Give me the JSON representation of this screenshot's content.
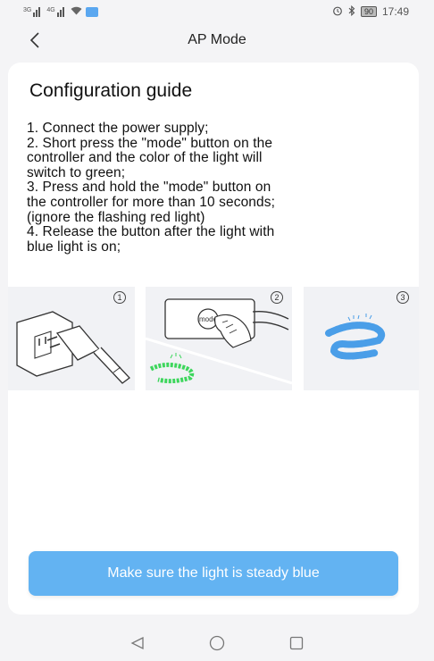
{
  "status_bar": {
    "sig1_tag": "3G",
    "sig2_tag": "4G",
    "battery": "90",
    "time": "17:49"
  },
  "header": {
    "title": "AP Mode"
  },
  "guide": {
    "title": "Configuration guide",
    "lines": [
      "1. Connect the power supply;",
      "2. Short press the \"mode\" button on the",
      "controller and the color of the light will",
      "switch to green;",
      "3. Press and hold the \"mode\" button on",
      "the controller for more than 10 seconds;",
      "(ignore the flashing red light)",
      "4. Release the button after the light with",
      "blue light is on;"
    ]
  },
  "illustrations": [
    {
      "step": "1",
      "icon": "plug-icon"
    },
    {
      "step": "2",
      "icon": "mode-button-icon",
      "button_text": "mode"
    },
    {
      "step": "3",
      "icon": "blue-led-strip-icon"
    }
  ],
  "colors": {
    "accent": "#63b3f2",
    "led_green": "#3dd65c",
    "led_blue": "#4a9ee8",
    "background": "#f4f4f6"
  },
  "action": {
    "label": "Make sure the light is steady blue"
  }
}
